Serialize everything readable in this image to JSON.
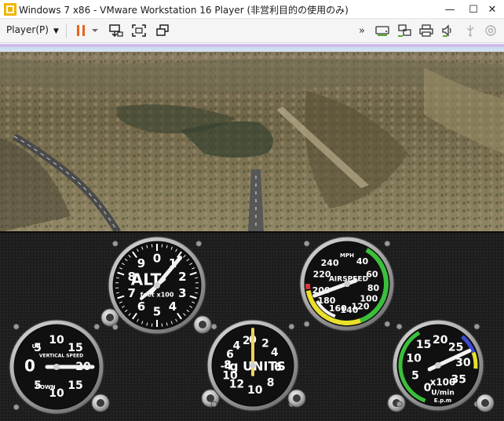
{
  "window": {
    "title": "Windows 7 x86 - VMware Workstation 16 Player (非営利目的の使用のみ)",
    "minimize_glyph": "—",
    "maximize_glyph": "☐",
    "close_glyph": "✕"
  },
  "toolbar": {
    "player_menu_label": "Player(P)",
    "buttons": [
      {
        "name": "pause-icon",
        "color": "#e8631a"
      },
      {
        "name": "dropdown-icon"
      },
      {
        "name": "send-ctrl-alt-del-icon"
      },
      {
        "name": "fit-guest-icon"
      },
      {
        "name": "unity-icon"
      }
    ],
    "right_icons": [
      "expand-icon",
      "hard-disk-icon",
      "network-icon",
      "printer-icon",
      "sound-icon",
      "usb-icon",
      "camera-icon"
    ]
  },
  "guest": {
    "scene": "flight-simulator",
    "sky_color": "#cfd9e8",
    "panel_color": "#1c1c1c",
    "gauges": {
      "altimeter": {
        "ticks": [
          "0",
          "1",
          "2",
          "3",
          "4",
          "5",
          "6",
          "7",
          "8",
          "9"
        ],
        "label": "ALT",
        "sublabel": "feet x100"
      },
      "airspeed": {
        "ticks": [
          "40",
          "60",
          "80",
          "100",
          "120",
          "140",
          "160",
          "180",
          "200",
          "220",
          "240"
        ],
        "label": "AIRSPEED",
        "unit": "MPH"
      },
      "vertical_speed": {
        "ticks": [
          "0",
          "5",
          "10",
          "15",
          "20",
          "15",
          "10",
          "5"
        ],
        "label": "VERTICAL SPEED",
        "up": "UP",
        "down": "DOWN"
      },
      "g_meter": {
        "ticks": [
          "0",
          "2",
          "4",
          "6",
          "8",
          "10",
          "12",
          "10",
          "8",
          "6",
          "4",
          "2"
        ],
        "label": "g UNITS",
        "minus": "-4"
      },
      "tachometer": {
        "ticks": [
          "0",
          "5",
          "10",
          "15",
          "20",
          "25",
          "30",
          "35"
        ],
        "label": "x100",
        "unit": "U/min",
        "sub": "E.p.m"
      }
    }
  }
}
